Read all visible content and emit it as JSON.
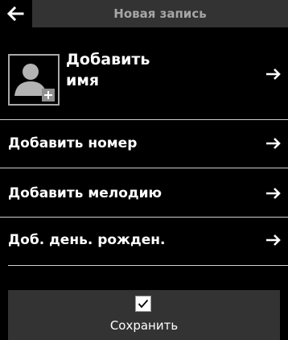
{
  "header": {
    "back_icon": "arrow-left-icon",
    "title": "Новая запись"
  },
  "contact": {
    "add_name_line1": "Добавить",
    "add_name_line2": "имя",
    "avatar_icon": "person-add-icon"
  },
  "menu": {
    "items": [
      {
        "label": "Добавить номер",
        "icon": "arrow-right-icon"
      },
      {
        "label": "Добавить мелодию",
        "icon": "arrow-right-icon"
      },
      {
        "label": "Доб. день. рожден.",
        "icon": "arrow-right-icon"
      }
    ]
  },
  "footer": {
    "save_icon": "checkbox-checked-icon",
    "save_label": "Сохранить"
  },
  "colors": {
    "background": "#000000",
    "bar": "#333333",
    "title_text": "#a6a6a6",
    "divider": "#cfcfcf",
    "text": "#ffffff"
  }
}
